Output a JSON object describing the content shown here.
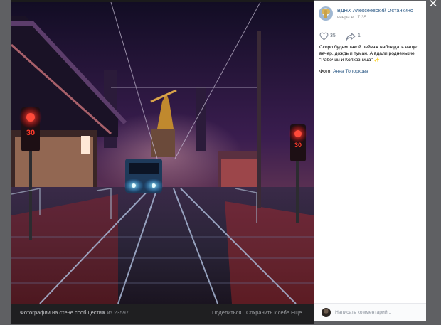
{
  "viewer": {
    "close_icon": "close-icon",
    "photo_alt": "Night tram stop in the rain with red traffic lights and the Worker and Kolkhoz Woman statue in the distance",
    "signals": [
      "30",
      "30"
    ],
    "tram_sign": "",
    "footer": {
      "album": "Фотографии на стене сообщества",
      "counter": "14 из 23597",
      "share": "Поделиться",
      "save": "Сохранить к себе",
      "more": "Ещё"
    }
  },
  "panel": {
    "author": "ВДНХ Алексеевский Останкино",
    "time": "вчера в 17:35",
    "likes": "35",
    "shares": "1",
    "like_icon": "heart-icon",
    "share_icon": "share-arrow-icon",
    "text": "Скоро будем такой пейзаж наблюдать чаще: вечер, дождь и туман. А вдали родненькие \"Рабочий и Колхозница\"",
    "emoji": "✨",
    "credit_label": "Фото:",
    "credit_name": "Анна Топоркова",
    "comment_placeholder": "Написать комментарий..."
  },
  "colors": {
    "link": "#2a5885",
    "viewer_bg": "#1b1b1c",
    "overlay": "#5f6063",
    "signal_red": "#ff2a2a",
    "tram_blue": "#6fe6ff"
  }
}
